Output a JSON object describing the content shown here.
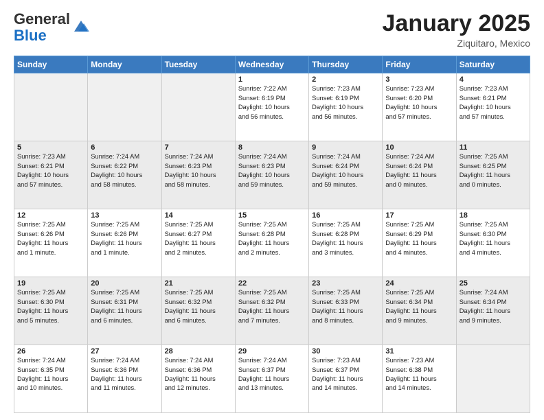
{
  "header": {
    "logo_general": "General",
    "logo_blue": "Blue",
    "month": "January 2025",
    "location": "Ziquitaro, Mexico"
  },
  "days_of_week": [
    "Sunday",
    "Monday",
    "Tuesday",
    "Wednesday",
    "Thursday",
    "Friday",
    "Saturday"
  ],
  "weeks": [
    [
      {
        "day": "",
        "info": ""
      },
      {
        "day": "",
        "info": ""
      },
      {
        "day": "",
        "info": ""
      },
      {
        "day": "1",
        "info": "Sunrise: 7:22 AM\nSunset: 6:19 PM\nDaylight: 10 hours\nand 56 minutes."
      },
      {
        "day": "2",
        "info": "Sunrise: 7:23 AM\nSunset: 6:19 PM\nDaylight: 10 hours\nand 56 minutes."
      },
      {
        "day": "3",
        "info": "Sunrise: 7:23 AM\nSunset: 6:20 PM\nDaylight: 10 hours\nand 57 minutes."
      },
      {
        "day": "4",
        "info": "Sunrise: 7:23 AM\nSunset: 6:21 PM\nDaylight: 10 hours\nand 57 minutes."
      }
    ],
    [
      {
        "day": "5",
        "info": "Sunrise: 7:23 AM\nSunset: 6:21 PM\nDaylight: 10 hours\nand 57 minutes."
      },
      {
        "day": "6",
        "info": "Sunrise: 7:24 AM\nSunset: 6:22 PM\nDaylight: 10 hours\nand 58 minutes."
      },
      {
        "day": "7",
        "info": "Sunrise: 7:24 AM\nSunset: 6:23 PM\nDaylight: 10 hours\nand 58 minutes."
      },
      {
        "day": "8",
        "info": "Sunrise: 7:24 AM\nSunset: 6:23 PM\nDaylight: 10 hours\nand 59 minutes."
      },
      {
        "day": "9",
        "info": "Sunrise: 7:24 AM\nSunset: 6:24 PM\nDaylight: 10 hours\nand 59 minutes."
      },
      {
        "day": "10",
        "info": "Sunrise: 7:24 AM\nSunset: 6:24 PM\nDaylight: 11 hours\nand 0 minutes."
      },
      {
        "day": "11",
        "info": "Sunrise: 7:25 AM\nSunset: 6:25 PM\nDaylight: 11 hours\nand 0 minutes."
      }
    ],
    [
      {
        "day": "12",
        "info": "Sunrise: 7:25 AM\nSunset: 6:26 PM\nDaylight: 11 hours\nand 1 minute."
      },
      {
        "day": "13",
        "info": "Sunrise: 7:25 AM\nSunset: 6:26 PM\nDaylight: 11 hours\nand 1 minute."
      },
      {
        "day": "14",
        "info": "Sunrise: 7:25 AM\nSunset: 6:27 PM\nDaylight: 11 hours\nand 2 minutes."
      },
      {
        "day": "15",
        "info": "Sunrise: 7:25 AM\nSunset: 6:28 PM\nDaylight: 11 hours\nand 2 minutes."
      },
      {
        "day": "16",
        "info": "Sunrise: 7:25 AM\nSunset: 6:28 PM\nDaylight: 11 hours\nand 3 minutes."
      },
      {
        "day": "17",
        "info": "Sunrise: 7:25 AM\nSunset: 6:29 PM\nDaylight: 11 hours\nand 4 minutes."
      },
      {
        "day": "18",
        "info": "Sunrise: 7:25 AM\nSunset: 6:30 PM\nDaylight: 11 hours\nand 4 minutes."
      }
    ],
    [
      {
        "day": "19",
        "info": "Sunrise: 7:25 AM\nSunset: 6:30 PM\nDaylight: 11 hours\nand 5 minutes."
      },
      {
        "day": "20",
        "info": "Sunrise: 7:25 AM\nSunset: 6:31 PM\nDaylight: 11 hours\nand 6 minutes."
      },
      {
        "day": "21",
        "info": "Sunrise: 7:25 AM\nSunset: 6:32 PM\nDaylight: 11 hours\nand 6 minutes."
      },
      {
        "day": "22",
        "info": "Sunrise: 7:25 AM\nSunset: 6:32 PM\nDaylight: 11 hours\nand 7 minutes."
      },
      {
        "day": "23",
        "info": "Sunrise: 7:25 AM\nSunset: 6:33 PM\nDaylight: 11 hours\nand 8 minutes."
      },
      {
        "day": "24",
        "info": "Sunrise: 7:25 AM\nSunset: 6:34 PM\nDaylight: 11 hours\nand 9 minutes."
      },
      {
        "day": "25",
        "info": "Sunrise: 7:24 AM\nSunset: 6:34 PM\nDaylight: 11 hours\nand 9 minutes."
      }
    ],
    [
      {
        "day": "26",
        "info": "Sunrise: 7:24 AM\nSunset: 6:35 PM\nDaylight: 11 hours\nand 10 minutes."
      },
      {
        "day": "27",
        "info": "Sunrise: 7:24 AM\nSunset: 6:36 PM\nDaylight: 11 hours\nand 11 minutes."
      },
      {
        "day": "28",
        "info": "Sunrise: 7:24 AM\nSunset: 6:36 PM\nDaylight: 11 hours\nand 12 minutes."
      },
      {
        "day": "29",
        "info": "Sunrise: 7:24 AM\nSunset: 6:37 PM\nDaylight: 11 hours\nand 13 minutes."
      },
      {
        "day": "30",
        "info": "Sunrise: 7:23 AM\nSunset: 6:37 PM\nDaylight: 11 hours\nand 14 minutes."
      },
      {
        "day": "31",
        "info": "Sunrise: 7:23 AM\nSunset: 6:38 PM\nDaylight: 11 hours\nand 14 minutes."
      },
      {
        "day": "",
        "info": ""
      }
    ]
  ]
}
